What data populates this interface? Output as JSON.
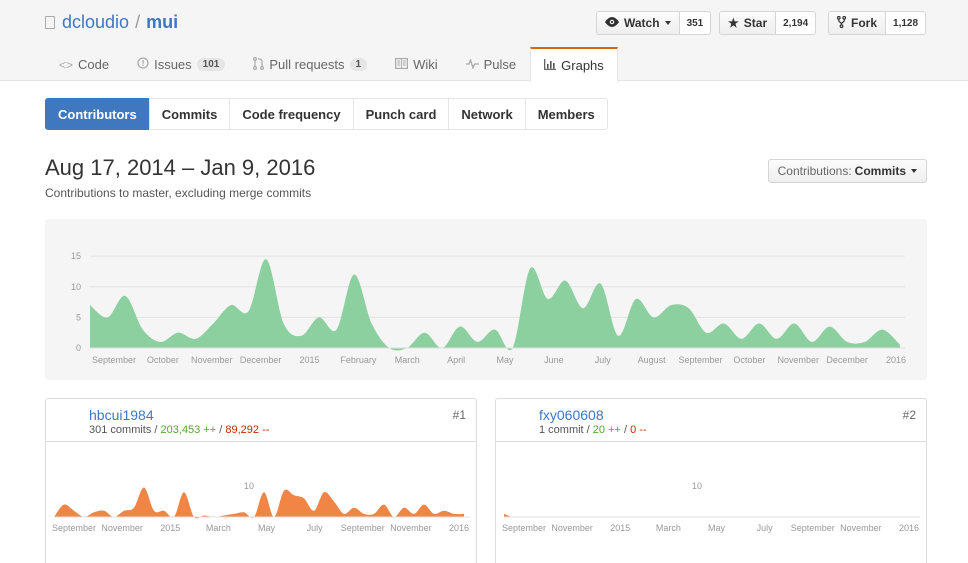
{
  "repo": {
    "owner": "dcloudio",
    "separator": "/",
    "name": "mui"
  },
  "actions": [
    {
      "label": "Watch",
      "count": "351",
      "icon": "eye-icon"
    },
    {
      "label": "Star",
      "count": "2,194",
      "icon": "star-icon"
    },
    {
      "label": "Fork",
      "count": "1,128",
      "icon": "fork-icon"
    }
  ],
  "reponav": [
    {
      "label": "Code",
      "icon": "code-icon"
    },
    {
      "label": "Issues",
      "count": "101",
      "icon": "issue-icon"
    },
    {
      "label": "Pull requests",
      "count": "1",
      "icon": "pull-request-icon"
    },
    {
      "label": "Wiki",
      "icon": "book-icon"
    },
    {
      "label": "Pulse",
      "icon": "pulse-icon"
    },
    {
      "label": "Graphs",
      "icon": "graph-icon",
      "selected": true
    }
  ],
  "subnav": [
    "Contributors",
    "Commits",
    "Code frequency",
    "Punch card",
    "Network",
    "Members"
  ],
  "range": {
    "title": "Aug 17, 2014 – Jan 9, 2016",
    "subtitle": "Contributions to master, excluding merge commits"
  },
  "contrib_select": {
    "prefix": "Contributions:",
    "value": "Commits"
  },
  "colors": {
    "link": "#4078c0",
    "main_area": "#8cd09f",
    "user_area": "#f08545",
    "add": "#55a532",
    "del": "#bd2c00"
  },
  "chart_data": [
    {
      "type": "area",
      "x_labels": [
        "September",
        "October",
        "November",
        "December",
        "2015",
        "February",
        "March",
        "April",
        "May",
        "June",
        "July",
        "August",
        "September",
        "October",
        "November",
        "December",
        "2016"
      ],
      "y_ticks": [
        0,
        5,
        10,
        15
      ],
      "ylim": [
        0,
        16
      ],
      "grid": true,
      "values": [
        7,
        5,
        8.5,
        3,
        1,
        2.5,
        1.5,
        4,
        7,
        6,
        14.5,
        4,
        2,
        5,
        3,
        12,
        4,
        0,
        0,
        2.5,
        0,
        3.5,
        1,
        3,
        0,
        13,
        8,
        11,
        6.5,
        10.5,
        2,
        8,
        5,
        7,
        6.5,
        2.5,
        4,
        1.5,
        4,
        1.5,
        4,
        1,
        3.5,
        1,
        1,
        3,
        0.5
      ]
    },
    {
      "type": "area",
      "x_labels": [
        "September",
        "November",
        "2015",
        "March",
        "May",
        "July",
        "September",
        "November",
        "2016"
      ],
      "y_ticks": [
        10
      ],
      "ylim": [
        0,
        20
      ],
      "values": [
        0,
        4,
        2,
        0,
        1.5,
        2,
        0,
        2,
        3,
        9.5,
        2,
        2,
        0,
        8,
        0,
        0.5,
        0,
        0.5,
        1,
        1.5,
        0,
        8,
        0,
        8.5,
        7,
        6,
        2,
        8,
        5,
        1,
        3,
        1,
        1,
        4,
        0,
        3,
        1,
        4,
        1,
        2,
        1,
        1
      ]
    },
    {
      "type": "area",
      "x_labels": [
        "September",
        "November",
        "2015",
        "March",
        "May",
        "July",
        "September",
        "November",
        "2016"
      ],
      "y_ticks": [
        10
      ],
      "ylim": [
        0,
        20
      ],
      "values": [
        1,
        0,
        0
      ]
    }
  ],
  "contributors": [
    {
      "name": "hbcui1984",
      "commits": "301 commits",
      "adds": "203,453 ++",
      "dels": "89,292 --",
      "rank": "#1",
      "avatar": "avatar-photo"
    },
    {
      "name": "fxy060608",
      "commits": "1 commit",
      "adds": "20 ++",
      "dels": "0 --",
      "rank": "#2",
      "avatar": "identicon"
    }
  ]
}
